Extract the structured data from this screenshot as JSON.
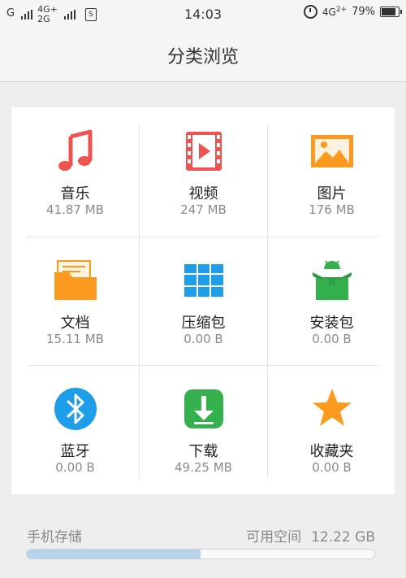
{
  "status_bar": {
    "carrier": "G",
    "net_top": "4G+",
    "net_bottom": "2G",
    "sim_label": "S",
    "time": "14:03",
    "net_right": "4G",
    "net_right_sup": "2+",
    "battery": "79%"
  },
  "header": {
    "title": "分类浏览"
  },
  "categories": [
    {
      "label": "音乐",
      "size": "41.87 MB",
      "icon": "music-note-icon",
      "color": "#ef5350"
    },
    {
      "label": "视频",
      "size": "247 MB",
      "icon": "film-play-icon",
      "color": "#ef5350"
    },
    {
      "label": "图片",
      "size": "176 MB",
      "icon": "image-icon",
      "color": "#fb9a1e"
    },
    {
      "label": "文档",
      "size": "15.11 MB",
      "icon": "folder-document-icon",
      "color": "#fb9a1e"
    },
    {
      "label": "压缩包",
      "size": "0.00 B",
      "icon": "archive-icon",
      "color": "#1e9de8"
    },
    {
      "label": "安装包",
      "size": "0.00 B",
      "icon": "android-package-icon",
      "color": "#34b14d"
    },
    {
      "label": "蓝牙",
      "size": "0.00 B",
      "icon": "bluetooth-icon",
      "color": "#1e9de8"
    },
    {
      "label": "下载",
      "size": "49.25 MB",
      "icon": "download-icon",
      "color": "#34b14d"
    },
    {
      "label": "收藏夹",
      "size": "0.00 B",
      "icon": "star-icon",
      "color": "#fb9a1e"
    }
  ],
  "storage": {
    "title": "手机存储",
    "available_label": "可用空间",
    "available_value": "12.22 GB",
    "used_fraction": 0.5
  }
}
